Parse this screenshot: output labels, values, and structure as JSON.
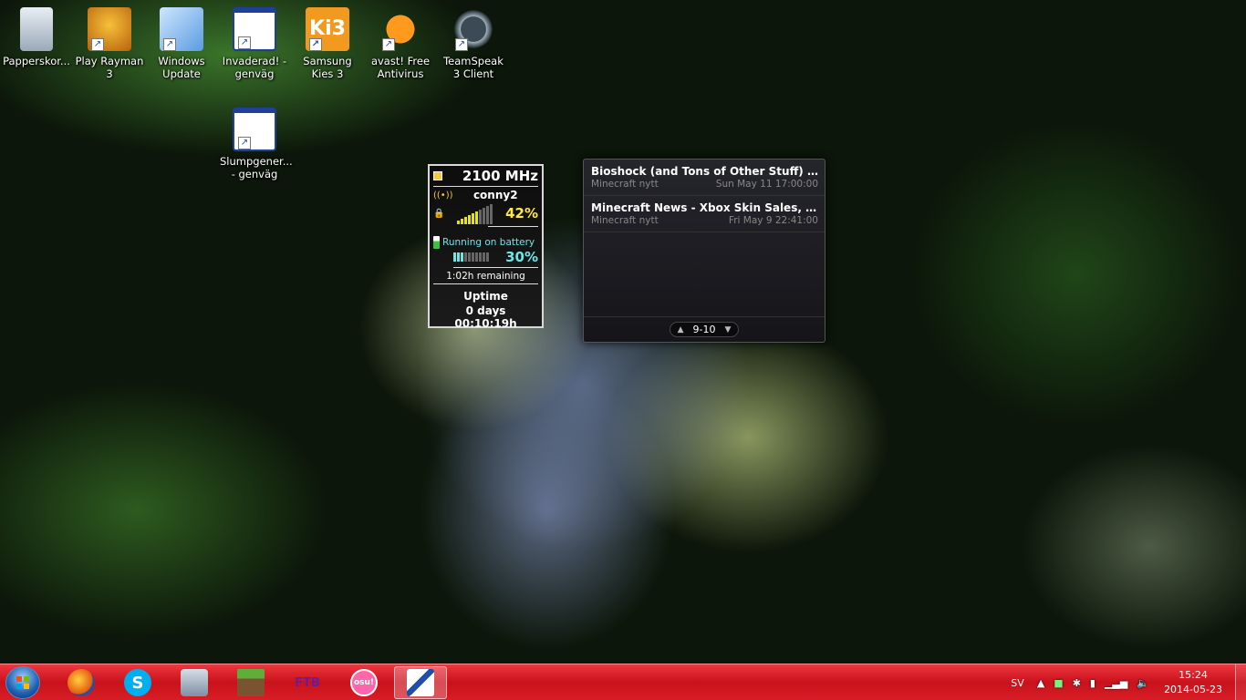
{
  "desktop_icons": [
    {
      "label": "Papperskor...",
      "icon": "recycle-bin-icon"
    },
    {
      "label": "Play Rayman 3",
      "icon": "rayman-icon"
    },
    {
      "label": "Windows Update",
      "icon": "windows-update-icon"
    },
    {
      "label": "Invaderad! - genväg",
      "icon": "app-window-icon"
    },
    {
      "label": "Samsung Kies 3",
      "icon": "samsung-kies-icon",
      "glyph": "Ki3"
    },
    {
      "label": "avast! Free Antivirus",
      "icon": "avast-icon"
    },
    {
      "label": "TeamSpeak 3 Client",
      "icon": "teamspeak-icon"
    },
    {
      "label": "Slumpgener... - genväg",
      "icon": "app-window-icon"
    }
  ],
  "system_gadget": {
    "cpu": "2100 MHz",
    "network_name": "conny2",
    "signal_percent": "42%",
    "battery_status": "Running on battery",
    "battery_percent": "30%",
    "battery_level": 0.3,
    "remaining": "1:02h remaining",
    "uptime_label": "Uptime",
    "uptime": "0 days 00:10:19h"
  },
  "feed_gadget": {
    "items": [
      {
        "title": "Bioshock (and Tons of Other Stuff) Revis...",
        "source": "Minecraft nytt",
        "date": "Sun May 11 17:00:00"
      },
      {
        "title": "Minecraft News - Xbox Skin Sales, Sidew...",
        "source": "Minecraft nytt",
        "date": "Fri May 9 22:41:00"
      }
    ],
    "pager": "9-10"
  },
  "taskbar": {
    "buttons": [
      {
        "name": "firefox-icon",
        "glyph": ""
      },
      {
        "name": "skype-icon",
        "glyph": "S"
      },
      {
        "name": "file-manager-icon",
        "glyph": ""
      },
      {
        "name": "minecraft-icon",
        "glyph": ""
      },
      {
        "name": "ftb-launcher-icon",
        "glyph": "FTB"
      },
      {
        "name": "osu-icon",
        "glyph": "osu!"
      },
      {
        "name": "paint-icon",
        "glyph": ""
      }
    ],
    "language": "SV",
    "time": "15:24",
    "date": "2014-05-23"
  },
  "colors": {
    "taskbar": "#d81d26",
    "signal_yellow": "#ffe94a",
    "battery_cyan": "#6ee6e6"
  }
}
